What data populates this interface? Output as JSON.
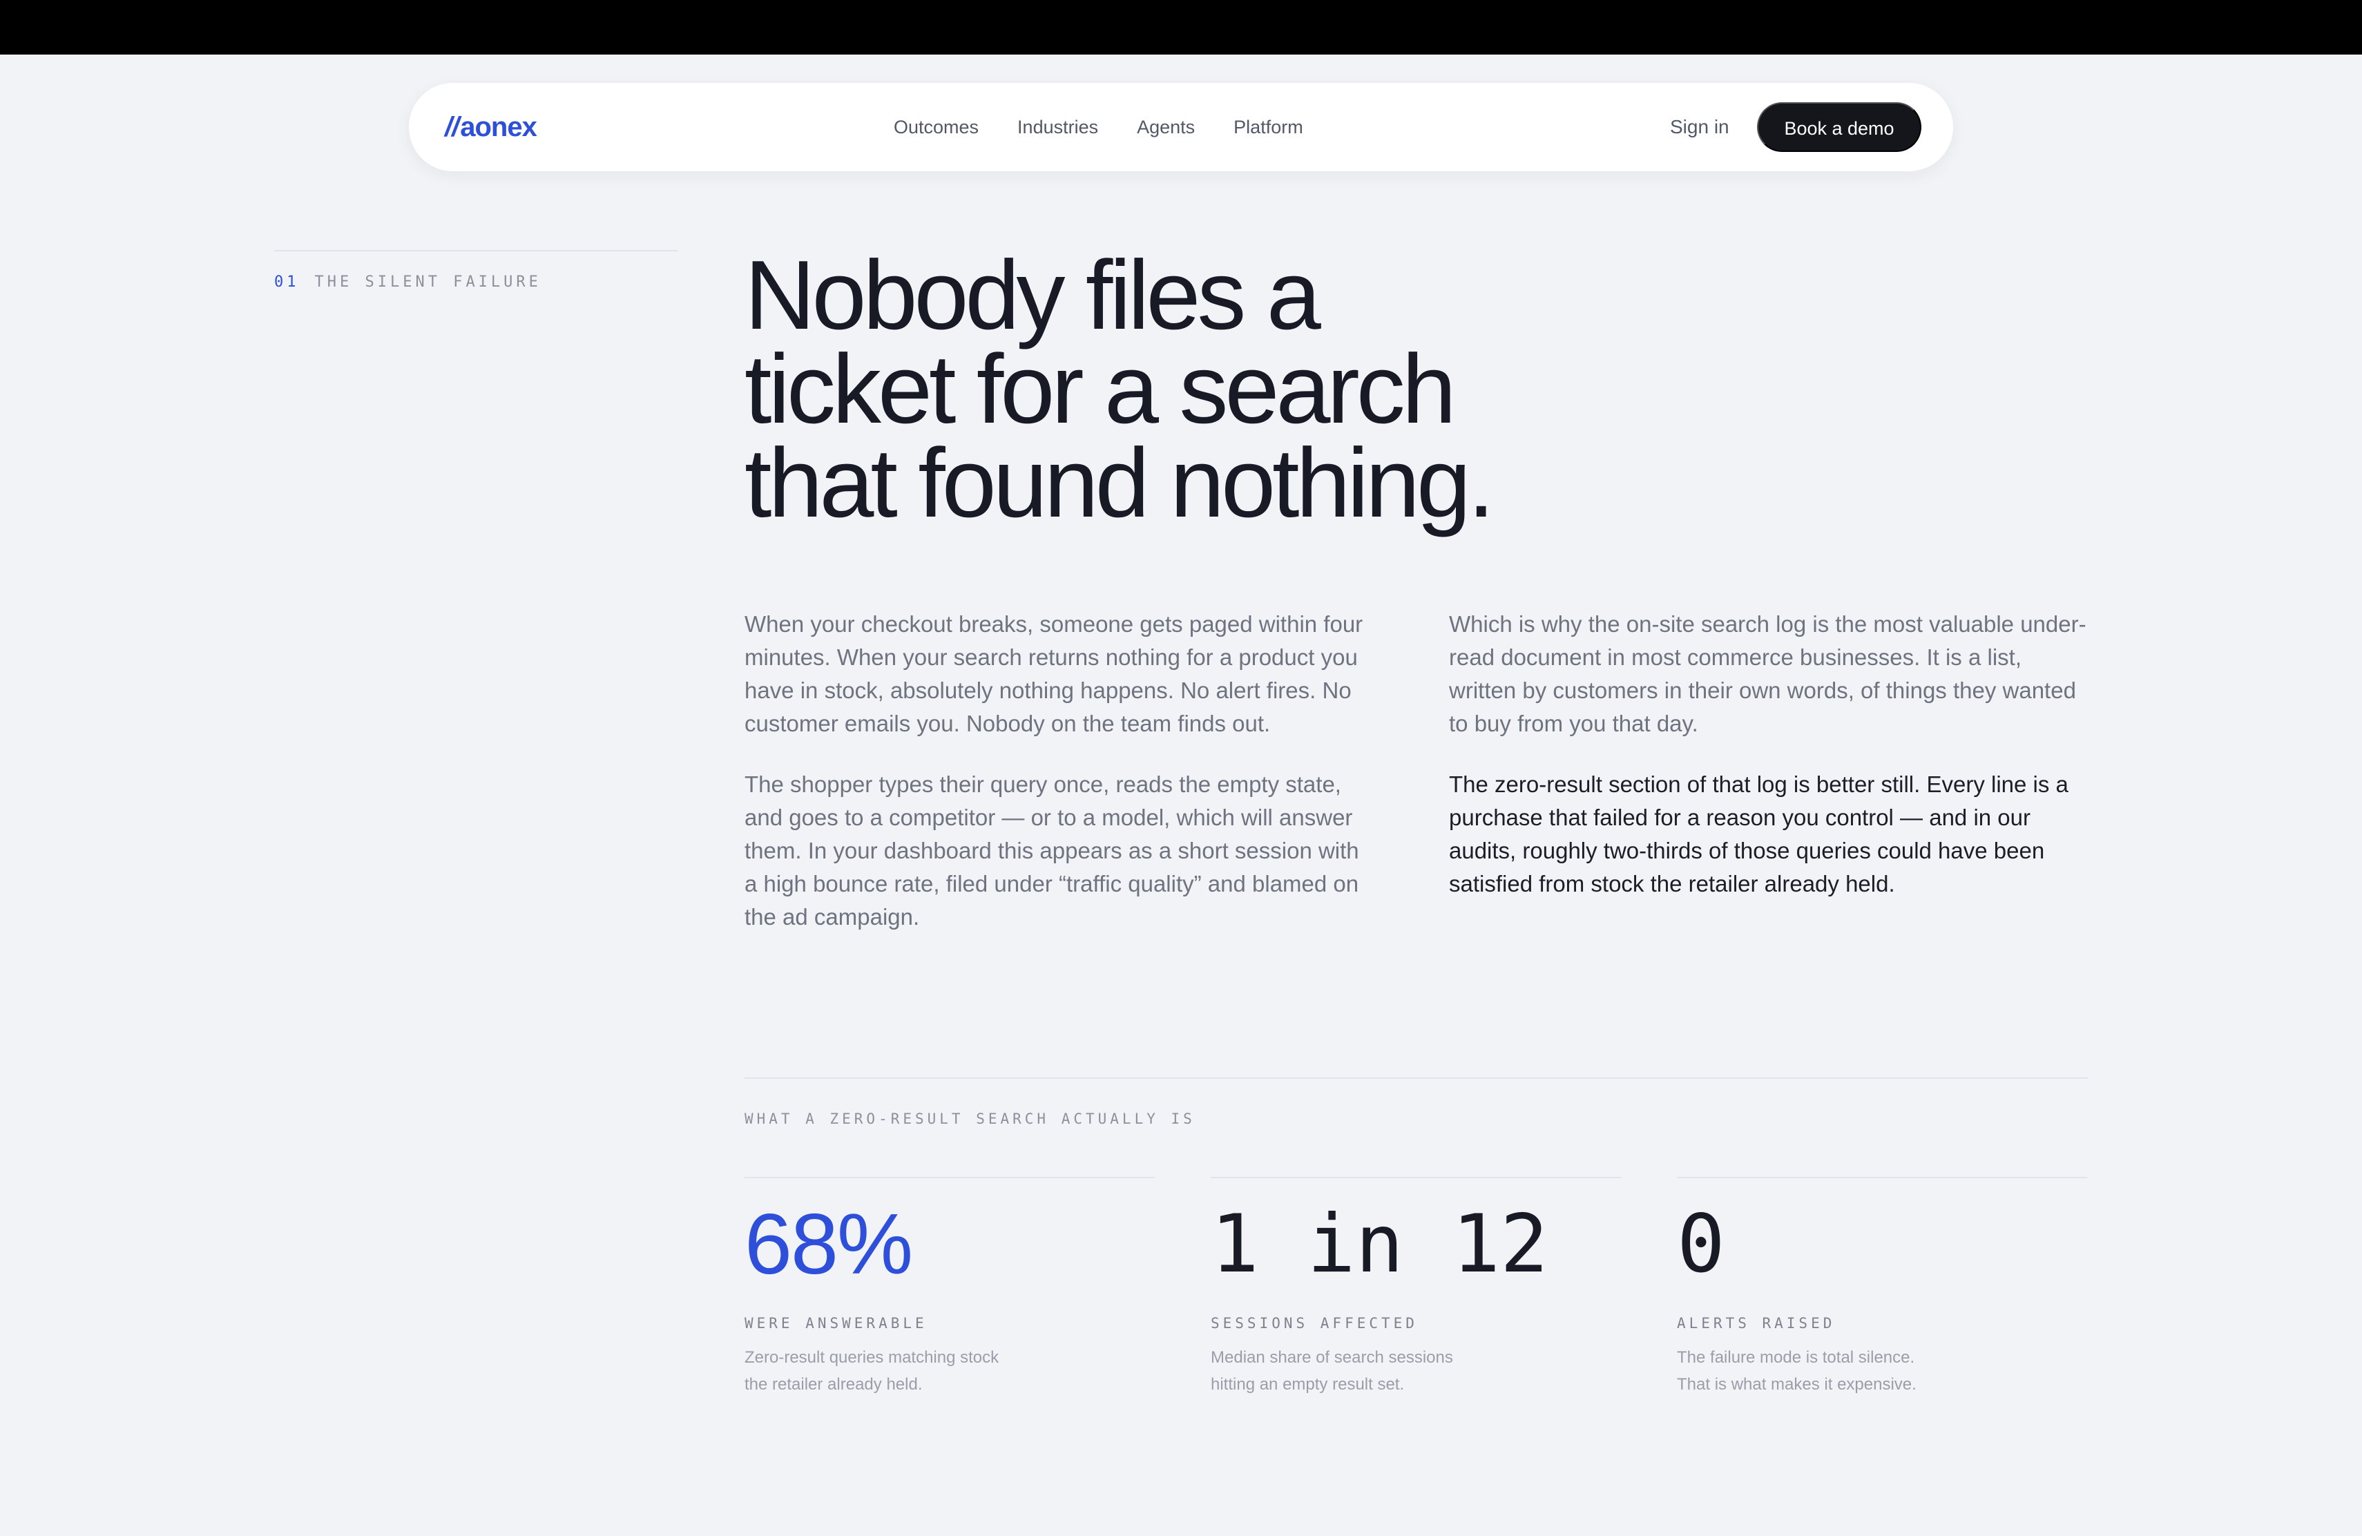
{
  "nav": {
    "logo": "aonex",
    "logo_prefix": "//",
    "links": [
      "Outcomes",
      "Industries",
      "Agents",
      "Platform"
    ],
    "signin": "Sign in",
    "cta": "Book a demo"
  },
  "section": {
    "number": "01",
    "label": "THE SILENT FAILURE",
    "headline": [
      "Nobody files a",
      "ticket for a search",
      "that found nothing."
    ]
  },
  "body": {
    "left": [
      "When your checkout breaks, someone gets paged within four minutes. When your search returns nothing for a product you have in stock, absolutely nothing happens. No alert fires. No customer emails you. Nobody on the team finds out.",
      "The shopper types their query once, reads the empty state, and goes to a competitor — or to a model, which will answer them. In your dashboard this appears as a short session with a high bounce rate, filed under “traffic quality” and blamed on the ad campaign."
    ],
    "right": [
      "Which is why the on-site search log is the most valuable under-read document in most commerce businesses. It is a list, written by customers in their own words, of things they wanted to buy from you that day.",
      "The zero-result section of that log is better still. Every line is a purchase that failed for a reason you control — and in our audits, roughly two-thirds of those queries could have been satisfied from stock the retailer already held."
    ]
  },
  "stats": {
    "label": "WHAT A ZERO-RESULT SEARCH ACTUALLY IS",
    "items": [
      {
        "value": "68%",
        "title": "WERE ANSWERABLE",
        "desc": "Zero-result queries matching stock the retailer already held."
      },
      {
        "value": "1 in 12",
        "title": "SESSIONS AFFECTED",
        "desc": "Median share of search sessions hitting an empty result set."
      },
      {
        "value": "0",
        "title": "ALERTS RAISED",
        "desc": "The failure mode is total silence. That is what makes it expensive."
      }
    ]
  },
  "colors": {
    "accent": "#2e4fd8",
    "background": "#f2f3f6",
    "text": "#181b26"
  }
}
